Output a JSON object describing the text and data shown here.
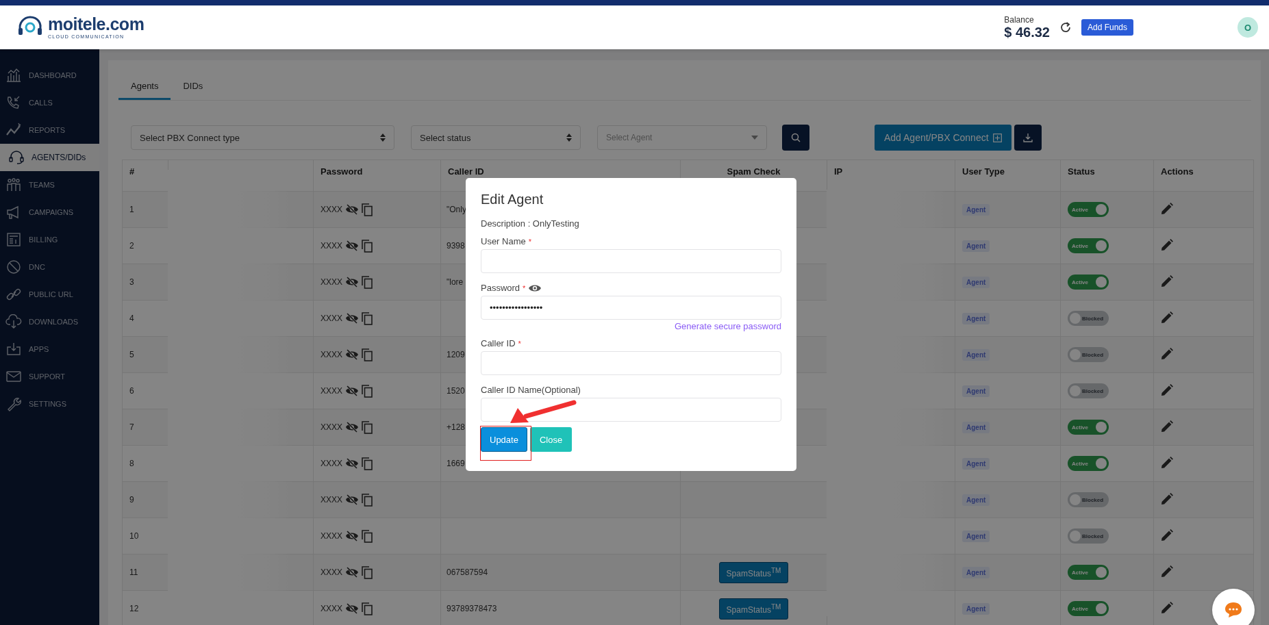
{
  "header": {
    "logo_name": "moitele.com",
    "logo_tagline": "CLOUD COMMUNICATION",
    "balance_label": "Balance",
    "balance": "$ 46.32",
    "add_funds": "Add Funds",
    "avatar": "O"
  },
  "sidebar": {
    "items": [
      {
        "label": "DASHBOARD",
        "kind": "dashboard",
        "selected": false
      },
      {
        "label": "CALLS",
        "kind": "calls",
        "selected": false
      },
      {
        "label": "REPORTS",
        "kind": "reports",
        "selected": false
      },
      {
        "label": "AGENTS/DIDs",
        "kind": "agents",
        "selected": true
      },
      {
        "label": "TEAMS",
        "kind": "teams",
        "selected": false
      },
      {
        "label": "CAMPAIGNS",
        "kind": "campaigns",
        "selected": false
      },
      {
        "label": "BILLING",
        "kind": "billing",
        "selected": false
      },
      {
        "label": "DNC",
        "kind": "dnc",
        "selected": false
      },
      {
        "label": "PUBLIC URL",
        "kind": "link",
        "selected": false
      },
      {
        "label": "DOWNLOADS",
        "kind": "downloads",
        "selected": false
      },
      {
        "label": "APPS",
        "kind": "apps",
        "selected": false
      },
      {
        "label": "SUPPORT",
        "kind": "support",
        "selected": false
      },
      {
        "label": "SETTINGS",
        "kind": "settings",
        "selected": false
      }
    ]
  },
  "tabs": [
    {
      "label": "Agents",
      "selected": true
    },
    {
      "label": "DIDs",
      "selected": false
    }
  ],
  "filters": {
    "pbx_type": "Select PBX Connect type",
    "status": "Select status",
    "agent_placeholder": "Select Agent",
    "add_button": "Add Agent/PBX Connect"
  },
  "table": {
    "columns": [
      "#",
      "Password",
      "Caller ID",
      "Spam Check",
      "IP",
      "User Type",
      "Status",
      "Actions"
    ],
    "rows": [
      {
        "num": "1",
        "password": "XXXX",
        "caller_id": "\"Only",
        "user_type": "Agent",
        "status": {
          "on": true,
          "label": "Active"
        }
      },
      {
        "num": "2",
        "password": "XXXX",
        "caller_id": "9398",
        "user_type": "Agent",
        "status": {
          "on": true,
          "label": "Active"
        }
      },
      {
        "num": "3",
        "password": "XXXX",
        "caller_id": "\"lore",
        "user_type": "Agent",
        "status": {
          "on": true,
          "label": "Active"
        }
      },
      {
        "num": "4",
        "password": "XXXX",
        "user_type": "Agent",
        "status": {
          "on": false,
          "label": "Blocked"
        }
      },
      {
        "num": "5",
        "password": "XXXX",
        "caller_id": "1209",
        "user_type": "Agent",
        "status": {
          "on": false,
          "label": "Blocked"
        }
      },
      {
        "num": "6",
        "password": "XXXX",
        "caller_id": "1520",
        "user_type": "Agent",
        "status": {
          "on": false,
          "label": "Blocked"
        }
      },
      {
        "num": "7",
        "password": "XXXX",
        "caller_id": "+128",
        "user_type": "Agent",
        "status": {
          "on": true,
          "label": "Active"
        }
      },
      {
        "num": "8",
        "password": "XXXX",
        "caller_id": "1669",
        "user_type": "Agent",
        "status": {
          "on": true,
          "label": "Active"
        }
      },
      {
        "num": "9",
        "password": "XXXX",
        "user_type": "Agent",
        "status": {
          "on": false,
          "label": "Blocked"
        }
      },
      {
        "num": "10",
        "password": "XXXX",
        "user_type": "Agent",
        "status": {
          "on": false,
          "label": "Blocked"
        }
      },
      {
        "num": "11",
        "password": "XXXX",
        "caller_id": "067587594",
        "spam": "SpamStatus$^{TM}$",
        "user_type": "Agent",
        "status": {
          "on": true,
          "label": "Active"
        }
      },
      {
        "num": "12",
        "password": "XXXX",
        "caller_id": "93789378473",
        "spam": "SpamStatus$^{TM}$",
        "user_type": "Agent",
        "status": {
          "on": true,
          "label": "Active"
        }
      }
    ]
  },
  "modal": {
    "title": "Edit Agent",
    "description": "Description : OnlyTesting",
    "fields": [
      {
        "label": "User Name",
        "required_mark": "*"
      },
      {
        "label": "Password",
        "required_mark": "*",
        "kind": "password",
        "value": "•••••••••••••••••"
      },
      {
        "label": "Caller ID",
        "required_mark": "*"
      },
      {
        "label": "Caller ID Name(Optional)"
      }
    ],
    "generate_link": "Generate secure password",
    "update": "Update",
    "close": "Close"
  }
}
